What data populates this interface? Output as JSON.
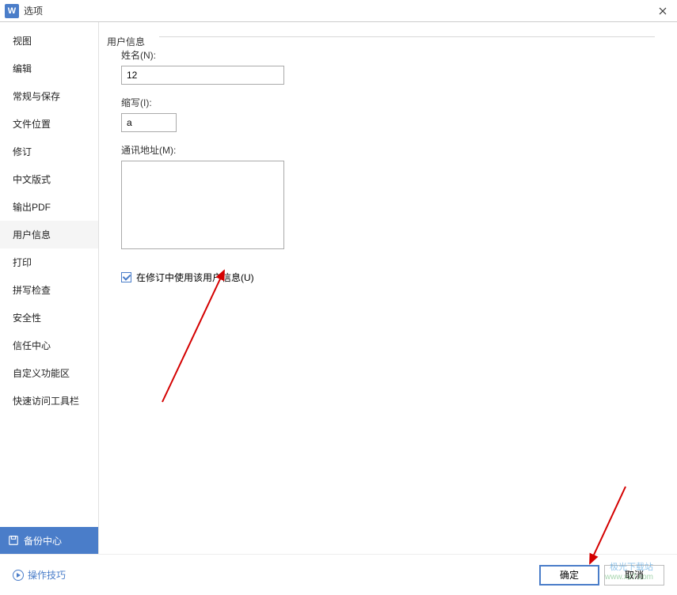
{
  "titlebar": {
    "app_letter": "W",
    "title": "选项"
  },
  "sidebar": {
    "items": [
      {
        "label": "视图"
      },
      {
        "label": "编辑"
      },
      {
        "label": "常规与保存"
      },
      {
        "label": "文件位置"
      },
      {
        "label": "修订"
      },
      {
        "label": "中文版式"
      },
      {
        "label": "输出PDF"
      },
      {
        "label": "用户信息"
      },
      {
        "label": "打印"
      },
      {
        "label": "拼写检查"
      },
      {
        "label": "安全性"
      },
      {
        "label": "信任中心"
      },
      {
        "label": "自定义功能区"
      },
      {
        "label": "快速访问工具栏"
      }
    ],
    "backup_center": "备份中心"
  },
  "content": {
    "section_title": "用户信息",
    "name_label": "姓名(N):",
    "name_value": "12",
    "initials_label": "缩写(I):",
    "initials_value": "a",
    "address_label": "通讯地址(M):",
    "address_value": "",
    "checkbox_label": "在修订中使用该用户信息(U)"
  },
  "footer": {
    "tips": "操作技巧",
    "ok": "确定",
    "cancel": "取消"
  },
  "watermark": {
    "line1": "极光下载站",
    "line2": "www.xz7.com"
  }
}
